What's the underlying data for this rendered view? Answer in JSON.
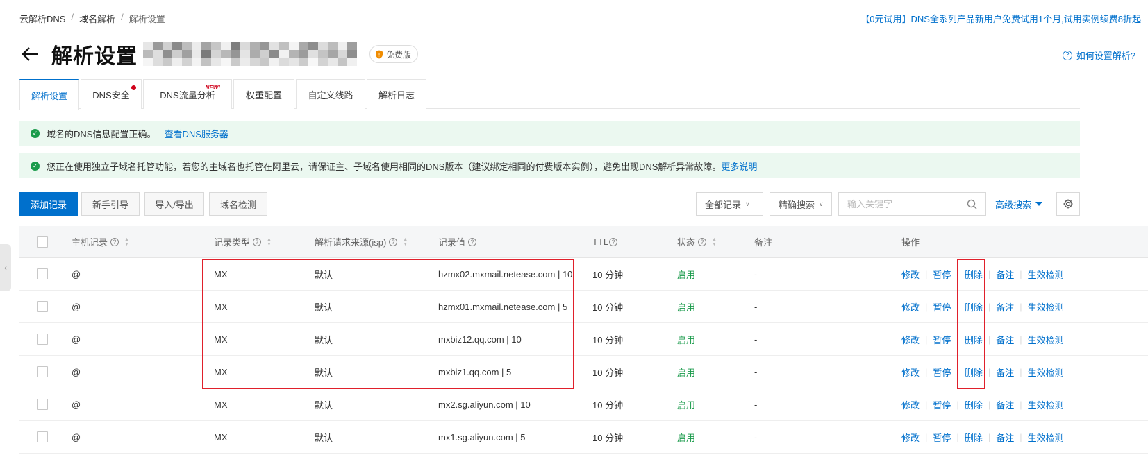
{
  "breadcrumb": [
    "云解析DNS",
    "域名解析",
    "解析设置"
  ],
  "breadcrumb_sep": "/",
  "promo": "【0元试用】DNS全系列产品新用户免费试用1个月,试用实例续费8折起",
  "title": "解析设置",
  "badge": "免费版",
  "help": "如何设置解析?",
  "tabs": [
    {
      "label": "解析设置",
      "active": true
    },
    {
      "label": "DNS安全",
      "dot": true
    },
    {
      "label": "DNS流量分析",
      "new": "NEW!"
    },
    {
      "label": "权重配置"
    },
    {
      "label": "自定义线路"
    },
    {
      "label": "解析日志"
    }
  ],
  "notices": [
    {
      "text": "域名的DNS信息配置正确。",
      "link": "查看DNS服务器"
    },
    {
      "text": "您正在使用独立子域名托管功能，若您的主域名也托管在阿里云，请保证主、子域名使用相同的DNS版本（建议绑定相同的付费版本实例），避免出现DNS解析异常故障。",
      "link": "更多说明"
    }
  ],
  "toolbar": {
    "add": "添加记录",
    "guide": "新手引导",
    "import": "导入/导出",
    "check": "域名检测",
    "filter": "全部记录",
    "mode": "精确搜索",
    "search_placeholder": "输入关键字",
    "advanced": "高级搜索"
  },
  "columns": [
    "主机记录",
    "记录类型",
    "解析请求来源(isp)",
    "记录值",
    "TTL",
    "状态",
    "备注",
    "操作"
  ],
  "actions": [
    "修改",
    "暂停",
    "删除",
    "备注",
    "生效检测"
  ],
  "rows": [
    {
      "host": "@",
      "type": "MX",
      "isp": "默认",
      "value": "hzmx02.mxmail.netease.com | 10",
      "ttl": "10 分钟",
      "status": "启用",
      "remark": "-"
    },
    {
      "host": "@",
      "type": "MX",
      "isp": "默认",
      "value": "hzmx01.mxmail.netease.com | 5",
      "ttl": "10 分钟",
      "status": "启用",
      "remark": "-"
    },
    {
      "host": "@",
      "type": "MX",
      "isp": "默认",
      "value": "mxbiz12.qq.com | 10",
      "ttl": "10 分钟",
      "status": "启用",
      "remark": "-"
    },
    {
      "host": "@",
      "type": "MX",
      "isp": "默认",
      "value": "mxbiz1.qq.com | 5",
      "ttl": "10 分钟",
      "status": "启用",
      "remark": "-"
    },
    {
      "host": "@",
      "type": "MX",
      "isp": "默认",
      "value": "mx2.sg.aliyun.com | 10",
      "ttl": "10 分钟",
      "status": "启用",
      "remark": "-"
    },
    {
      "host": "@",
      "type": "MX",
      "isp": "默认",
      "value": "mx1.sg.aliyun.com | 5",
      "ttl": "10 分钟",
      "status": "启用",
      "remark": "-"
    }
  ],
  "colors": {
    "accent": "#0070cc",
    "success": "#1a9b4b",
    "highlight": "#e0202b"
  }
}
